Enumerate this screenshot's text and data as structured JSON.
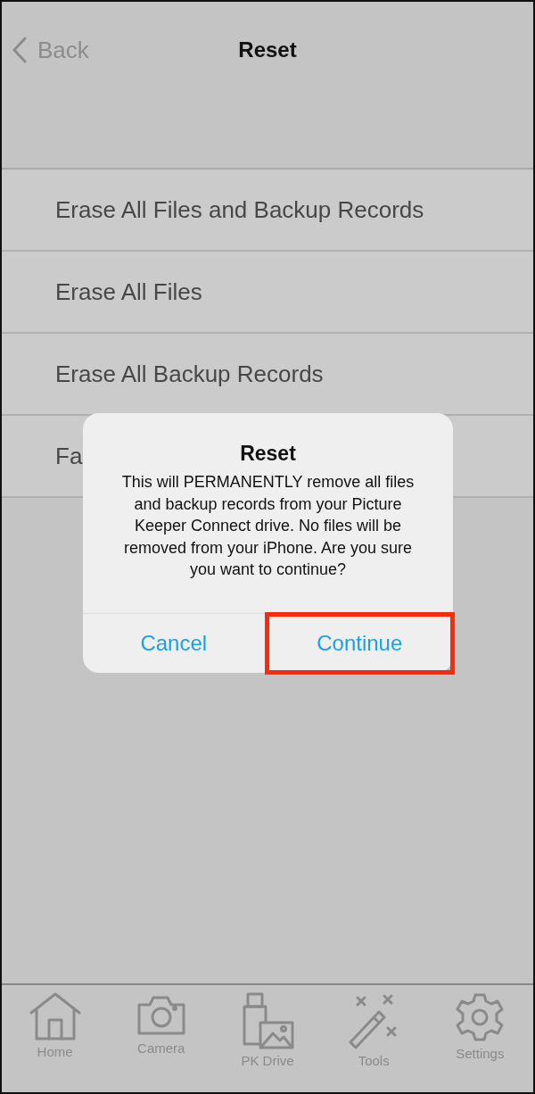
{
  "nav": {
    "back": "Back",
    "title": "Reset"
  },
  "rows": [
    "Erase All Files and Backup Records",
    "Erase All Files",
    "Erase All Backup Records",
    "Fa"
  ],
  "dialog": {
    "title": "Reset",
    "message": "This will PERMANENTLY remove all files and backup records from your Picture Keeper Connect drive. No files will be removed from your iPhone. Are you sure you want to continue?",
    "buttons": [
      {
        "label": "Cancel",
        "highlighted": false
      },
      {
        "label": "Continue",
        "highlighted": true
      }
    ]
  },
  "tabs": [
    {
      "kind": "home",
      "label": "Home"
    },
    {
      "kind": "camera",
      "label": "Camera"
    },
    {
      "kind": "drive",
      "label": "PK Drive"
    },
    {
      "kind": "tools",
      "label": "Tools"
    },
    {
      "kind": "settings",
      "label": "Settings"
    }
  ]
}
